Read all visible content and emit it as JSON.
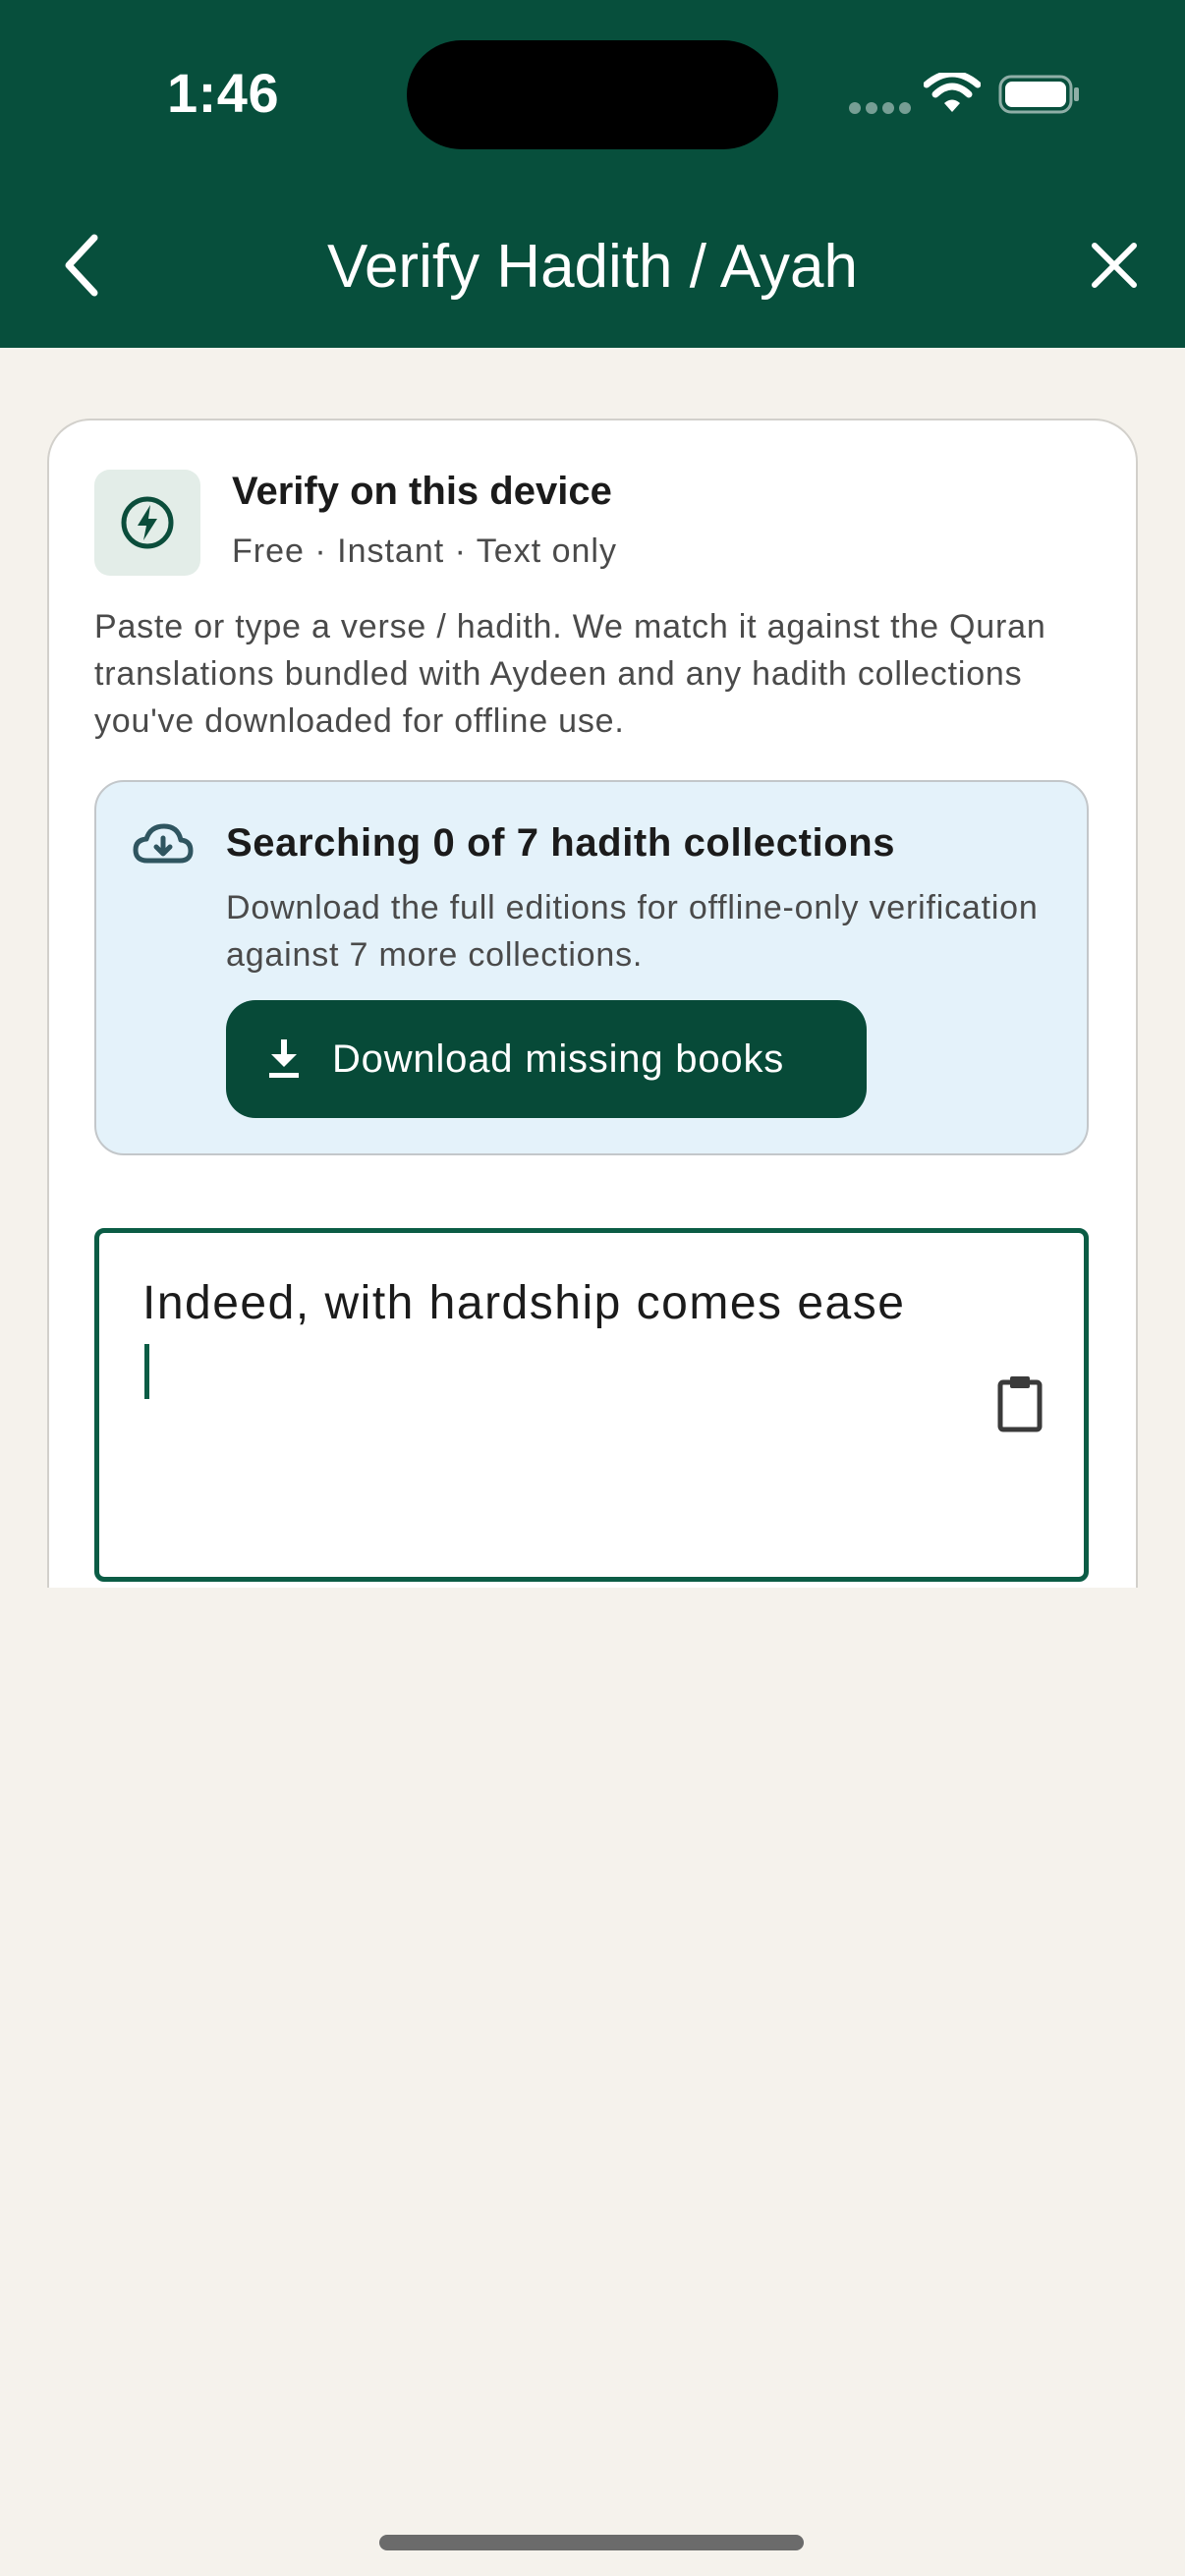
{
  "status_bar": {
    "time": "1:46"
  },
  "header": {
    "title": "Verify Hadith / Ayah",
    "back_icon": "chevron-left-icon",
    "close_icon": "close-icon"
  },
  "card": {
    "icon": "bolt-icon",
    "title": "Verify on this device",
    "subtitle": "Free · Instant · Text only",
    "description": "Paste or type a verse / hadith. We match it against the Quran translations bundled with Aydeen and any hadith collections you've downloaded for offline use."
  },
  "download_notice": {
    "icon": "cloud-download-icon",
    "title": "Searching 0 of 7 hadith collections",
    "description": "Download the full editions for offline-only verification against 7 more collections.",
    "button_label": "Download missing books",
    "button_icon": "download-icon"
  },
  "verse_input": {
    "value": "Indeed, with hardship comes ease",
    "paste_icon": "clipboard-icon"
  },
  "colors": {
    "header_bg": "#074F3C",
    "page_bg": "#F5F2EC",
    "accent": "#074A38",
    "info_bg": "#E4F2FA"
  }
}
